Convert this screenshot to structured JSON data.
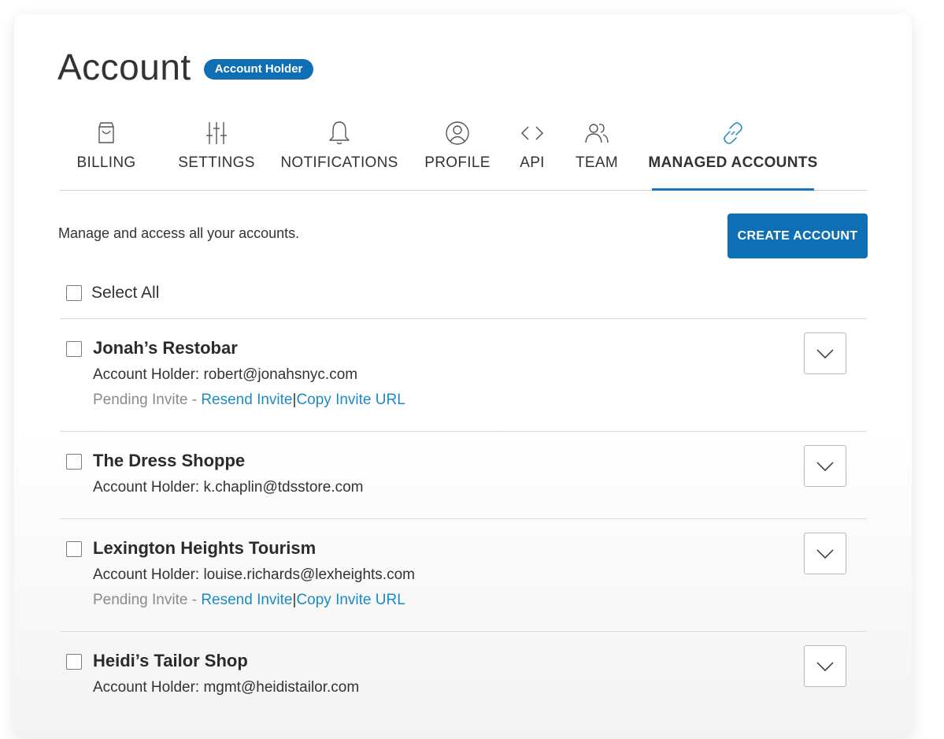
{
  "header": {
    "title": "Account",
    "badge": "Account Holder"
  },
  "tabs": [
    {
      "label": "BILLING",
      "icon": "bag-icon",
      "active": false
    },
    {
      "label": "SETTINGS",
      "icon": "sliders-icon",
      "active": false
    },
    {
      "label": "NOTIFICATIONS",
      "icon": "bell-icon",
      "active": false
    },
    {
      "label": "PROFILE",
      "icon": "user-circle-icon",
      "active": false
    },
    {
      "label": "API",
      "icon": "code-icon",
      "active": false
    },
    {
      "label": "TEAM",
      "icon": "team-icon",
      "active": false
    },
    {
      "label": "MANAGED ACCOUNTS",
      "icon": "link-icon",
      "active": true
    }
  ],
  "main": {
    "intro": "Manage and access all your accounts.",
    "create_button": "CREATE ACCOUNT",
    "select_all": "Select All"
  },
  "accounts": [
    {
      "name": "Jonah’s Restobar",
      "holder": "Account Holder: robert@jonahsnyc.com",
      "pending": "Pending Invite - ",
      "resend": "Resend Invite",
      "separator": "|",
      "copy": "Copy Invite URL"
    },
    {
      "name": "The Dress Shoppe",
      "holder": "Account Holder: k.chaplin@tdsstore.com"
    },
    {
      "name": "Lexington Heights Tourism",
      "holder": "Account Holder: louise.richards@lexheights.com",
      "pending": "Pending Invite - ",
      "resend": "Resend Invite",
      "separator": "|",
      "copy": "Copy Invite URL"
    },
    {
      "name": "Heidi’s Tailor Shop",
      "holder": "Account Holder: mgmt@heidistailor.com"
    }
  ],
  "colors": {
    "brand": "#0f6fb5",
    "link": "#1a8bc6",
    "active_tab_underline": "#1677c2",
    "pending_text": "#8a8a8a"
  }
}
